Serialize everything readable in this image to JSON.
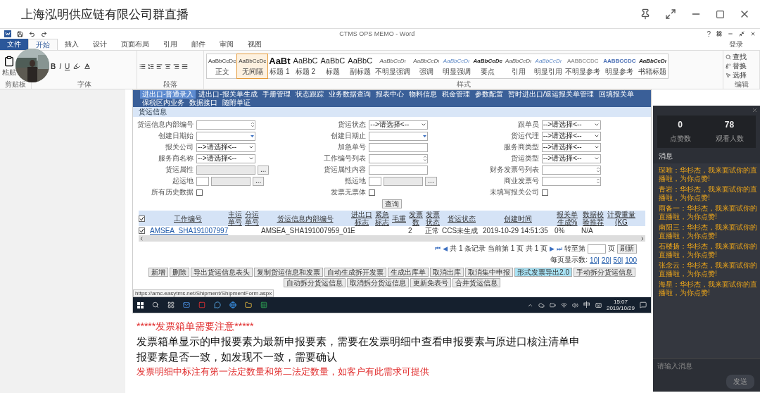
{
  "stream": {
    "title": "上海泓明供应链有限公司群直播"
  },
  "word": {
    "title": "CTMS OPS MEMO - Word",
    "help": "?",
    "account": "登录",
    "tabs": [
      {
        "label": "文件",
        "kind": "file",
        "selected": false
      },
      {
        "label": "开始",
        "kind": "tab",
        "selected": true
      },
      {
        "label": "插入",
        "kind": "tab",
        "selected": false
      },
      {
        "label": "设计",
        "kind": "tab",
        "selected": false
      },
      {
        "label": "页面布局",
        "kind": "tab",
        "selected": false
      },
      {
        "label": "引用",
        "kind": "tab",
        "selected": false
      },
      {
        "label": "邮件",
        "kind": "tab",
        "selected": false
      },
      {
        "label": "审阅",
        "kind": "tab",
        "selected": false
      },
      {
        "label": "视图",
        "kind": "tab",
        "selected": false
      }
    ],
    "ribbon": {
      "clipboard": {
        "paste": "粘贴",
        "label": "剪贴板"
      },
      "font": {
        "label": "字体",
        "buttons": [
          "B",
          "I",
          "U"
        ]
      },
      "paragraph": {
        "label": "段落"
      },
      "styles": {
        "label": "样式",
        "items": [
          {
            "sample": "AaBbCcDc",
            "label": "正文",
            "selected": false,
            "kind": "plain"
          },
          {
            "sample": "AaBbCcDc",
            "label": "无间隔",
            "selected": true,
            "kind": "plain"
          },
          {
            "sample": "AaBt",
            "label": "标题 1",
            "selected": false,
            "kind": "big"
          },
          {
            "sample": "AaBbC",
            "label": "标题 2",
            "selected": false,
            "kind": "medium"
          },
          {
            "sample": "AaBbC",
            "label": "标题",
            "selected": false,
            "kind": "medium"
          },
          {
            "sample": "AaBbC",
            "label": "副标题",
            "selected": false,
            "kind": "medium"
          },
          {
            "sample": "AaBbCcDı",
            "label": "不明显强调",
            "selected": false,
            "kind": "italic"
          },
          {
            "sample": "AaBbCcDı",
            "label": "强调",
            "selected": false,
            "kind": "italic"
          },
          {
            "sample": "AaBbCcDı",
            "label": "明显强调",
            "selected": false,
            "kind": "accent"
          },
          {
            "sample": "AaBbCcDc",
            "label": "要点",
            "selected": false,
            "kind": "bold"
          },
          {
            "sample": "AaBbCcDı",
            "label": "引用",
            "selected": false,
            "kind": "italic"
          },
          {
            "sample": "AaBbCcDı",
            "label": "明显引用",
            "selected": false,
            "kind": "accent"
          },
          {
            "sample": "AABBCCDC",
            "label": "不明显参考",
            "selected": false,
            "kind": "caps"
          },
          {
            "sample": "AABBCCDC",
            "label": "明显参考",
            "selected": false,
            "kind": "accentcaps"
          },
          {
            "sample": "AaBbCcDı",
            "label": "书籍标题",
            "selected": false,
            "kind": "bold"
          }
        ]
      },
      "editing": {
        "label": "编辑",
        "items": [
          "查找",
          "替换",
          "选择"
        ]
      }
    }
  },
  "app": {
    "nav": [
      {
        "label": "进出口-普通录入",
        "selected": true
      },
      {
        "label": "进出口-报关单生成",
        "selected": false
      },
      {
        "label": "手册管理",
        "selected": false
      },
      {
        "label": "状态跟踪",
        "selected": false
      },
      {
        "label": "业务数据查询",
        "selected": false
      },
      {
        "label": "报表中心",
        "selected": false
      },
      {
        "label": "物料信息",
        "selected": false
      },
      {
        "label": "税金管理",
        "selected": false
      },
      {
        "label": "参数配置",
        "selected": false
      },
      {
        "label": "暂时进出口/退运报关单管理",
        "selected": false
      },
      {
        "label": "回填报关单",
        "selected": false
      },
      {
        "label": "保税区内业务",
        "selected": false
      },
      {
        "label": "数据接口",
        "selected": false
      },
      {
        "label": "随附单证",
        "selected": false
      }
    ],
    "section": "货运信息",
    "fields": [
      {
        "label": "货运信息内部编号",
        "kind": "textarea"
      },
      {
        "label": "货运状态",
        "kind": "select",
        "value": "-->请选择<--"
      },
      {
        "label": "跟单员",
        "kind": "select",
        "value": "-->请选择<--"
      },
      {
        "label": "创建日期始",
        "kind": "date"
      },
      {
        "label": "创建日期止",
        "kind": "date"
      },
      {
        "label": "货运代理",
        "kind": "select",
        "value": "-->请选择<--"
      },
      {
        "label": "报关公司",
        "kind": "select",
        "value": "-->请选择<--"
      },
      {
        "label": "加急单号",
        "kind": "text"
      },
      {
        "label": "服务商类型",
        "kind": "select",
        "value": "-->请选择<--"
      },
      {
        "label": "服务商名称",
        "kind": "select",
        "value": "-->请选择<--"
      },
      {
        "label": "工作编号列表",
        "kind": "textarea"
      },
      {
        "label": "货运类型",
        "kind": "select",
        "value": "-->请选择<--"
      },
      {
        "label": "货运属性",
        "kind": "lookup",
        "button": "..."
      },
      {
        "label": "货运属性内容",
        "kind": "text"
      },
      {
        "label": "财务发票号列表",
        "kind": "textarea"
      },
      {
        "label": "起运地",
        "kind": "place",
        "button": "..."
      },
      {
        "label": "抵运地",
        "kind": "place",
        "button": "..."
      },
      {
        "label": "商业发票号",
        "kind": "textarea"
      },
      {
        "label": "所有历史数据",
        "kind": "checkbox",
        "checked": false
      },
      {
        "label": "发票无票体",
        "kind": "checkbox",
        "checked": false
      },
      {
        "label": "未填写报关公司",
        "kind": "checkbox",
        "checked": false
      }
    ],
    "search_button": "查询",
    "table": {
      "all_checked": true,
      "columns": [
        "工作编号",
        "主运单号",
        "分运单号",
        "货运信息内部编号",
        "进出口标志",
        "紧急标志",
        "毛重",
        "发票数",
        "发票状态",
        "货运状态",
        "创建时间",
        "报关单生成%",
        "数据校验推荐",
        "计费重量(KG"
      ],
      "rows": [
        {
          "checked": true,
          "cells": [
            "AMSEA_SHA191007997",
            "",
            "",
            "AMSEA_SHA191007959_01",
            "E",
            "",
            "",
            "2",
            "正常",
            "CCS未生成",
            "2019-10-29 14:51:35",
            "0%",
            "N/A",
            ""
          ]
        }
      ]
    },
    "pagination": {
      "first": "⏮",
      "prev": "◀",
      "summary": "共 1 条记录 当前第 1 页 共 1 页",
      "next": "▶",
      "last": "⏭",
      "goto": "转至第",
      "page_unit": "页",
      "refresh": "刷新",
      "per_page_label": "每页显示数:",
      "per_page": [
        "10|",
        "20|",
        "50|",
        "100"
      ]
    },
    "actions": [
      {
        "label": "新增",
        "selected": false
      },
      {
        "label": "删除",
        "selected": false
      },
      {
        "label": "导出货运信息表头",
        "selected": false
      },
      {
        "label": "复制货运信息和发票",
        "selected": false
      },
      {
        "label": "自动生成拆开发票",
        "selected": false
      },
      {
        "label": "生成出库单",
        "selected": false
      },
      {
        "label": "取消出库",
        "selected": false
      },
      {
        "label": "取消集中申报",
        "selected": false
      },
      {
        "label": "形式发票导出2.0",
        "selected": true
      },
      {
        "label": "手动拆分货运信息",
        "selected": false
      },
      {
        "label": "自动拆分货运信息",
        "selected": false
      },
      {
        "label": "取消拆分货运信息",
        "selected": false
      },
      {
        "label": "更新免表号",
        "selected": false
      },
      {
        "label": "合并货运信息",
        "selected": false
      }
    ],
    "status_url": "https://amc.easytms.net/Shipment/ShipmentForm.aspx",
    "taskbar": {
      "ime": "中",
      "time": "15:07",
      "date": "2019/10/29"
    }
  },
  "paragraphs": [
    {
      "kind": "heading",
      "text": "*****发票箱单需要注意*****"
    },
    {
      "kind": "body",
      "text": "发票箱单显示的申报要素为最新申报要素，需要在发票明细中查看申报要素与原进口核注清单申报要素是否一致，如发现不一致，需要确认"
    },
    {
      "kind": "note",
      "text": "发票明细中标注有第一法定数量和第二法定数量，如客户有此需求可提供"
    }
  ],
  "chat": {
    "stats": [
      {
        "value": "0",
        "label": "点赞数"
      },
      {
        "value": "78",
        "label": "观看人数"
      }
    ],
    "heading": "消息",
    "messages": [
      {
        "name": "琛唯：",
        "text": "华杉杰，我来面试你的直播啦，为你点赞!"
      },
      {
        "name": "青岩：",
        "text": "华杉杰，我来面试你的直播啦，为你点赞!"
      },
      {
        "name": "雨备一：",
        "text": "华杉杰，我来面试你的直播啦，为你点赞!"
      },
      {
        "name": "南阳三：",
        "text": "华杉杰，我来面试你的直播啦，为你点赞!"
      },
      {
        "name": "石楼扬：",
        "text": "华杉杰，我来面试你的直播啦，为你点赞!"
      },
      {
        "name": "张念云：",
        "text": "华杉杰，我来面试你的直播啦，为你点赞!"
      },
      {
        "name": "海星：",
        "text": "华杉杰，我来面试你的直播啦，为你点赞!"
      }
    ],
    "placeholder": "请输入消息",
    "send": "发送"
  }
}
